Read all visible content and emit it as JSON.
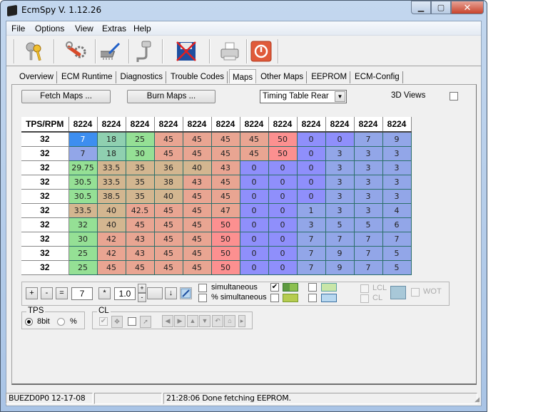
{
  "window": {
    "title": "EcmSpy V. 1.12.26"
  },
  "menu": [
    "File",
    "Options",
    "View",
    "Extras",
    "Help"
  ],
  "toolbar": {
    "icons": [
      "keys-icon",
      "settings-tools-icon",
      "chip-write-icon",
      "serial-cable-icon",
      "no-save-icon",
      "printer-icon",
      "power-icon"
    ]
  },
  "tabs": [
    {
      "label": "Overview",
      "active": false
    },
    {
      "label": "ECM Runtime",
      "active": false
    },
    {
      "label": "Diagnostics",
      "active": false
    },
    {
      "label": "Trouble Codes",
      "active": false
    },
    {
      "label": "Maps",
      "active": true
    },
    {
      "label": "Other Maps",
      "active": false
    },
    {
      "label": "EEPROM",
      "active": false
    },
    {
      "label": "ECM-Config",
      "active": false
    }
  ],
  "maps": {
    "fetch_label": "Fetch Maps ...",
    "burn_label": "Burn Maps ...",
    "table_select": "Timing Table Rear",
    "views3d_label": "3D Views",
    "views3d_checked": false
  },
  "table": {
    "corner": "TPS/RPM",
    "columns": [
      "8224",
      "8224",
      "8224",
      "8224",
      "8224",
      "8224",
      "8224",
      "8224",
      "8224",
      "8224",
      "8224",
      "8224"
    ],
    "rows": [
      {
        "tps": "32",
        "values": [
          7,
          18,
          25,
          45,
          45,
          45,
          45,
          50,
          0,
          0,
          7,
          9
        ]
      },
      {
        "tps": "32",
        "values": [
          7,
          18,
          30,
          45,
          45,
          45,
          45,
          50,
          0,
          3,
          3,
          3
        ]
      },
      {
        "tps": "32",
        "values": [
          29.75,
          33.5,
          35,
          36,
          40,
          43,
          0,
          0,
          0,
          3,
          3,
          3
        ]
      },
      {
        "tps": "32",
        "values": [
          30.5,
          33.5,
          35,
          38,
          43,
          45,
          0,
          0,
          0,
          3,
          3,
          3
        ]
      },
      {
        "tps": "32",
        "values": [
          30.5,
          38.5,
          35,
          40,
          45,
          45,
          0,
          0,
          0,
          3,
          3,
          3
        ]
      },
      {
        "tps": "32",
        "values": [
          33.5,
          40,
          42.5,
          45,
          45,
          47,
          0,
          0,
          1,
          3,
          3,
          4
        ]
      },
      {
        "tps": "32",
        "values": [
          32,
          40,
          45,
          45,
          45,
          50,
          0,
          0,
          3,
          5,
          5,
          6
        ]
      },
      {
        "tps": "32",
        "values": [
          30,
          42,
          43,
          45,
          45,
          50,
          0,
          0,
          7,
          7,
          7,
          7
        ]
      },
      {
        "tps": "32",
        "values": [
          25,
          42,
          43,
          45,
          45,
          50,
          0,
          0,
          7,
          9,
          7,
          5
        ]
      },
      {
        "tps": "32",
        "values": [
          25,
          45,
          45,
          45,
          45,
          50,
          0,
          0,
          7,
          9,
          7,
          5
        ]
      }
    ],
    "selected_cell": {
      "row": 0,
      "col": 0
    },
    "colors": {
      "selected": "#3d8ef0",
      "low": "#8f8ffb",
      "blue_mid": "#92a6e8",
      "teal": "#8fd0b0",
      "green": "#95e095",
      "tan": "#d3b690",
      "salmon": "#e9a592",
      "red": "#fc9090"
    }
  },
  "edit_bar": {
    "plus": "+",
    "minus": "-",
    "equals": "=",
    "value": "7",
    "multiply": "*",
    "factor": "1.0",
    "step_up": "+",
    "step_down": "-",
    "down_arrow": "↓",
    "simultaneous_label": "simultaneous",
    "pct_simultaneous_label": "% simultaneous",
    "simultaneous_checked": false,
    "pct_simultaneous_checked": false,
    "view_grid_checked": true,
    "view_solid_checked": false,
    "view_cross_checked": false,
    "view_graph_checked": false,
    "lcl_label": "LCL",
    "cl_label": "CL",
    "wot_label": "WOT"
  },
  "tps_group": {
    "title": "TPS",
    "options": [
      "8bit",
      "%"
    ],
    "selected": "8bit"
  },
  "cl_group": {
    "title": "CL"
  },
  "status": {
    "left": "BUEZD0P0 12-17-08",
    "middle": "",
    "message": "21:28:06 Done fetching EEPROM."
  }
}
